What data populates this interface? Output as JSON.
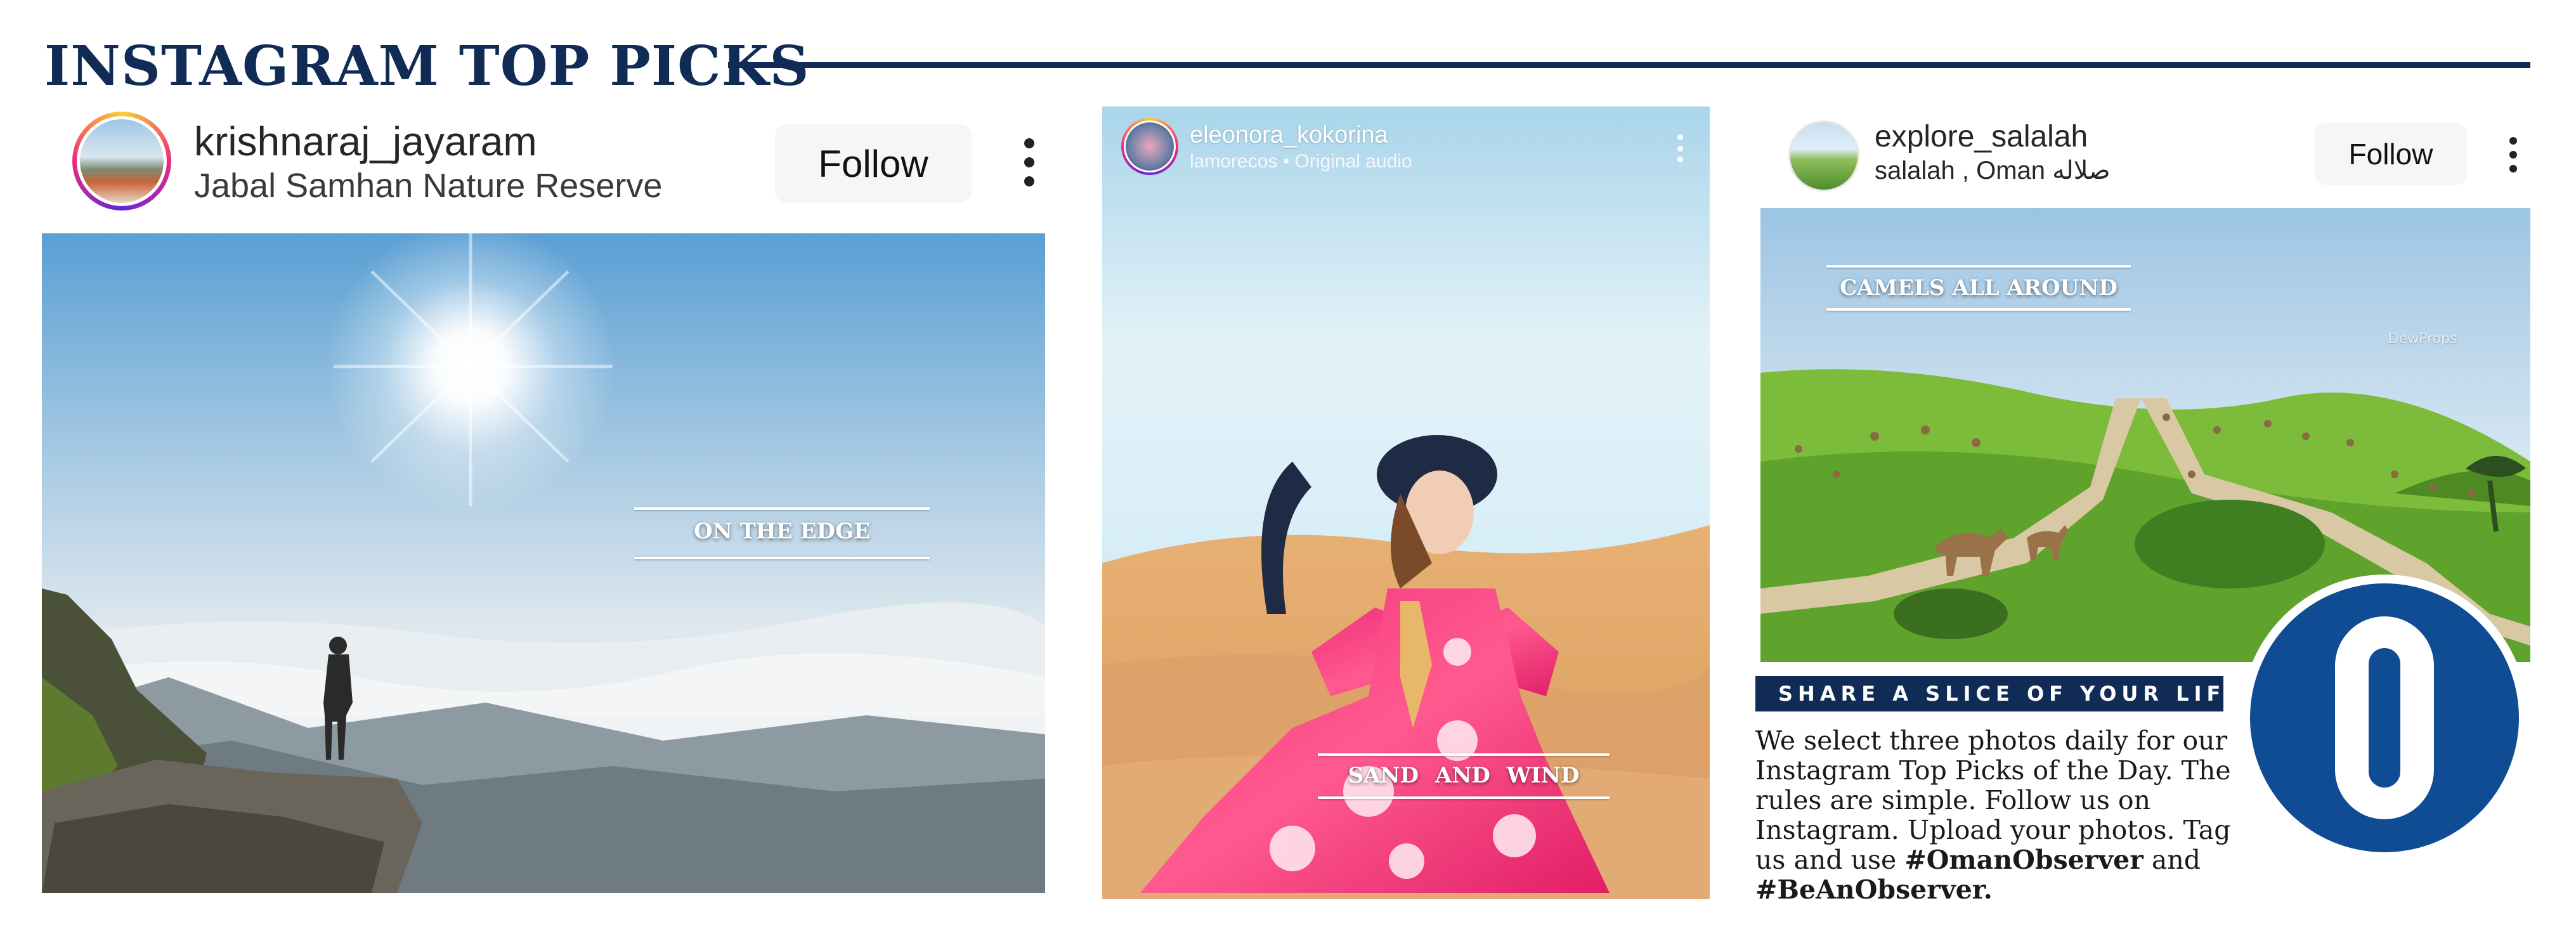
{
  "header": {
    "title": "INSTAGRAM TOP PICKS"
  },
  "posts": [
    {
      "username": "krishnaraj_jayaram",
      "subtitle": "Jabal Samhan Nature Reserve",
      "follow_label": "Follow",
      "caption": "ON THE EDGE"
    },
    {
      "username": "eleonora_kokorina",
      "subtitle": "lamorecos • Original audio",
      "caption": "SAND AND WIND"
    },
    {
      "username": "explore_salalah",
      "subtitle": "salalah , Oman صلاله",
      "follow_label": "Follow",
      "caption": "CAMELS ALL AROUND",
      "watermark": "DewProps"
    }
  ],
  "share": {
    "banner": "SHARE A SLICE OF YOUR LIFE",
    "body_1": "We select three photos daily for our Instagram Top Picks of the Day. The rules are simple. Follow us on Instagram. Upload your photos. Tag us and use ",
    "hashtag_1": "#OmanObserver",
    "body_2": " and ",
    "hashtag_2": "#BeAnObserver."
  },
  "colors": {
    "brand_navy": "#102c56",
    "logo_blue": "#0f4c93"
  }
}
